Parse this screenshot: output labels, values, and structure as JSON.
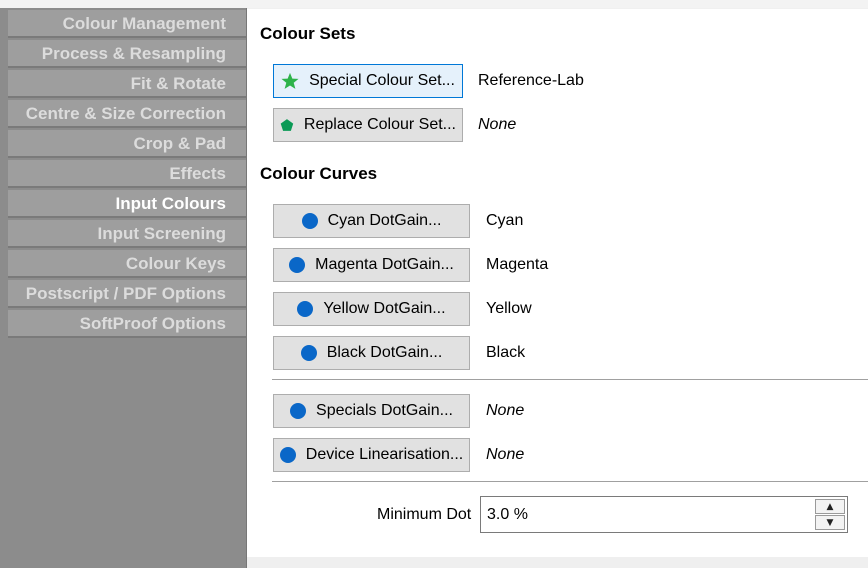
{
  "sidebar": {
    "items": [
      {
        "label": "Colour Management"
      },
      {
        "label": "Process & Resampling"
      },
      {
        "label": "Fit & Rotate"
      },
      {
        "label": "Centre & Size Correction"
      },
      {
        "label": "Crop & Pad"
      },
      {
        "label": "Effects"
      },
      {
        "label": "Input Colours",
        "selected": true
      },
      {
        "label": "Input Screening"
      },
      {
        "label": "Colour Keys"
      },
      {
        "label": "Postscript / PDF Options"
      },
      {
        "label": "SoftProof Options"
      }
    ]
  },
  "colour_sets": {
    "title": "Colour Sets",
    "special": {
      "button": "Special Colour Set...",
      "value": "Reference-Lab",
      "icon": "star-icon",
      "icon_color": "#2db34a"
    },
    "replace": {
      "button": "Replace Colour Set...",
      "value": "None",
      "icon": "pentagon-icon",
      "icon_color": "#0b9a56"
    }
  },
  "colour_curves": {
    "title": "Colour Curves",
    "icon_color": "#0a67c8",
    "cyan": {
      "button": "Cyan DotGain...",
      "value": "Cyan"
    },
    "magenta": {
      "button": "Magenta DotGain...",
      "value": "Magenta"
    },
    "yellow": {
      "button": "Yellow DotGain...",
      "value": "Yellow"
    },
    "black": {
      "button": "Black DotGain...",
      "value": "Black"
    },
    "specials": {
      "button": "Specials DotGain...",
      "value": "None"
    },
    "device": {
      "button": "Device Linearisation...",
      "value": "None"
    }
  },
  "minimum_dot": {
    "label": "Minimum Dot",
    "value": "3.0 %"
  }
}
